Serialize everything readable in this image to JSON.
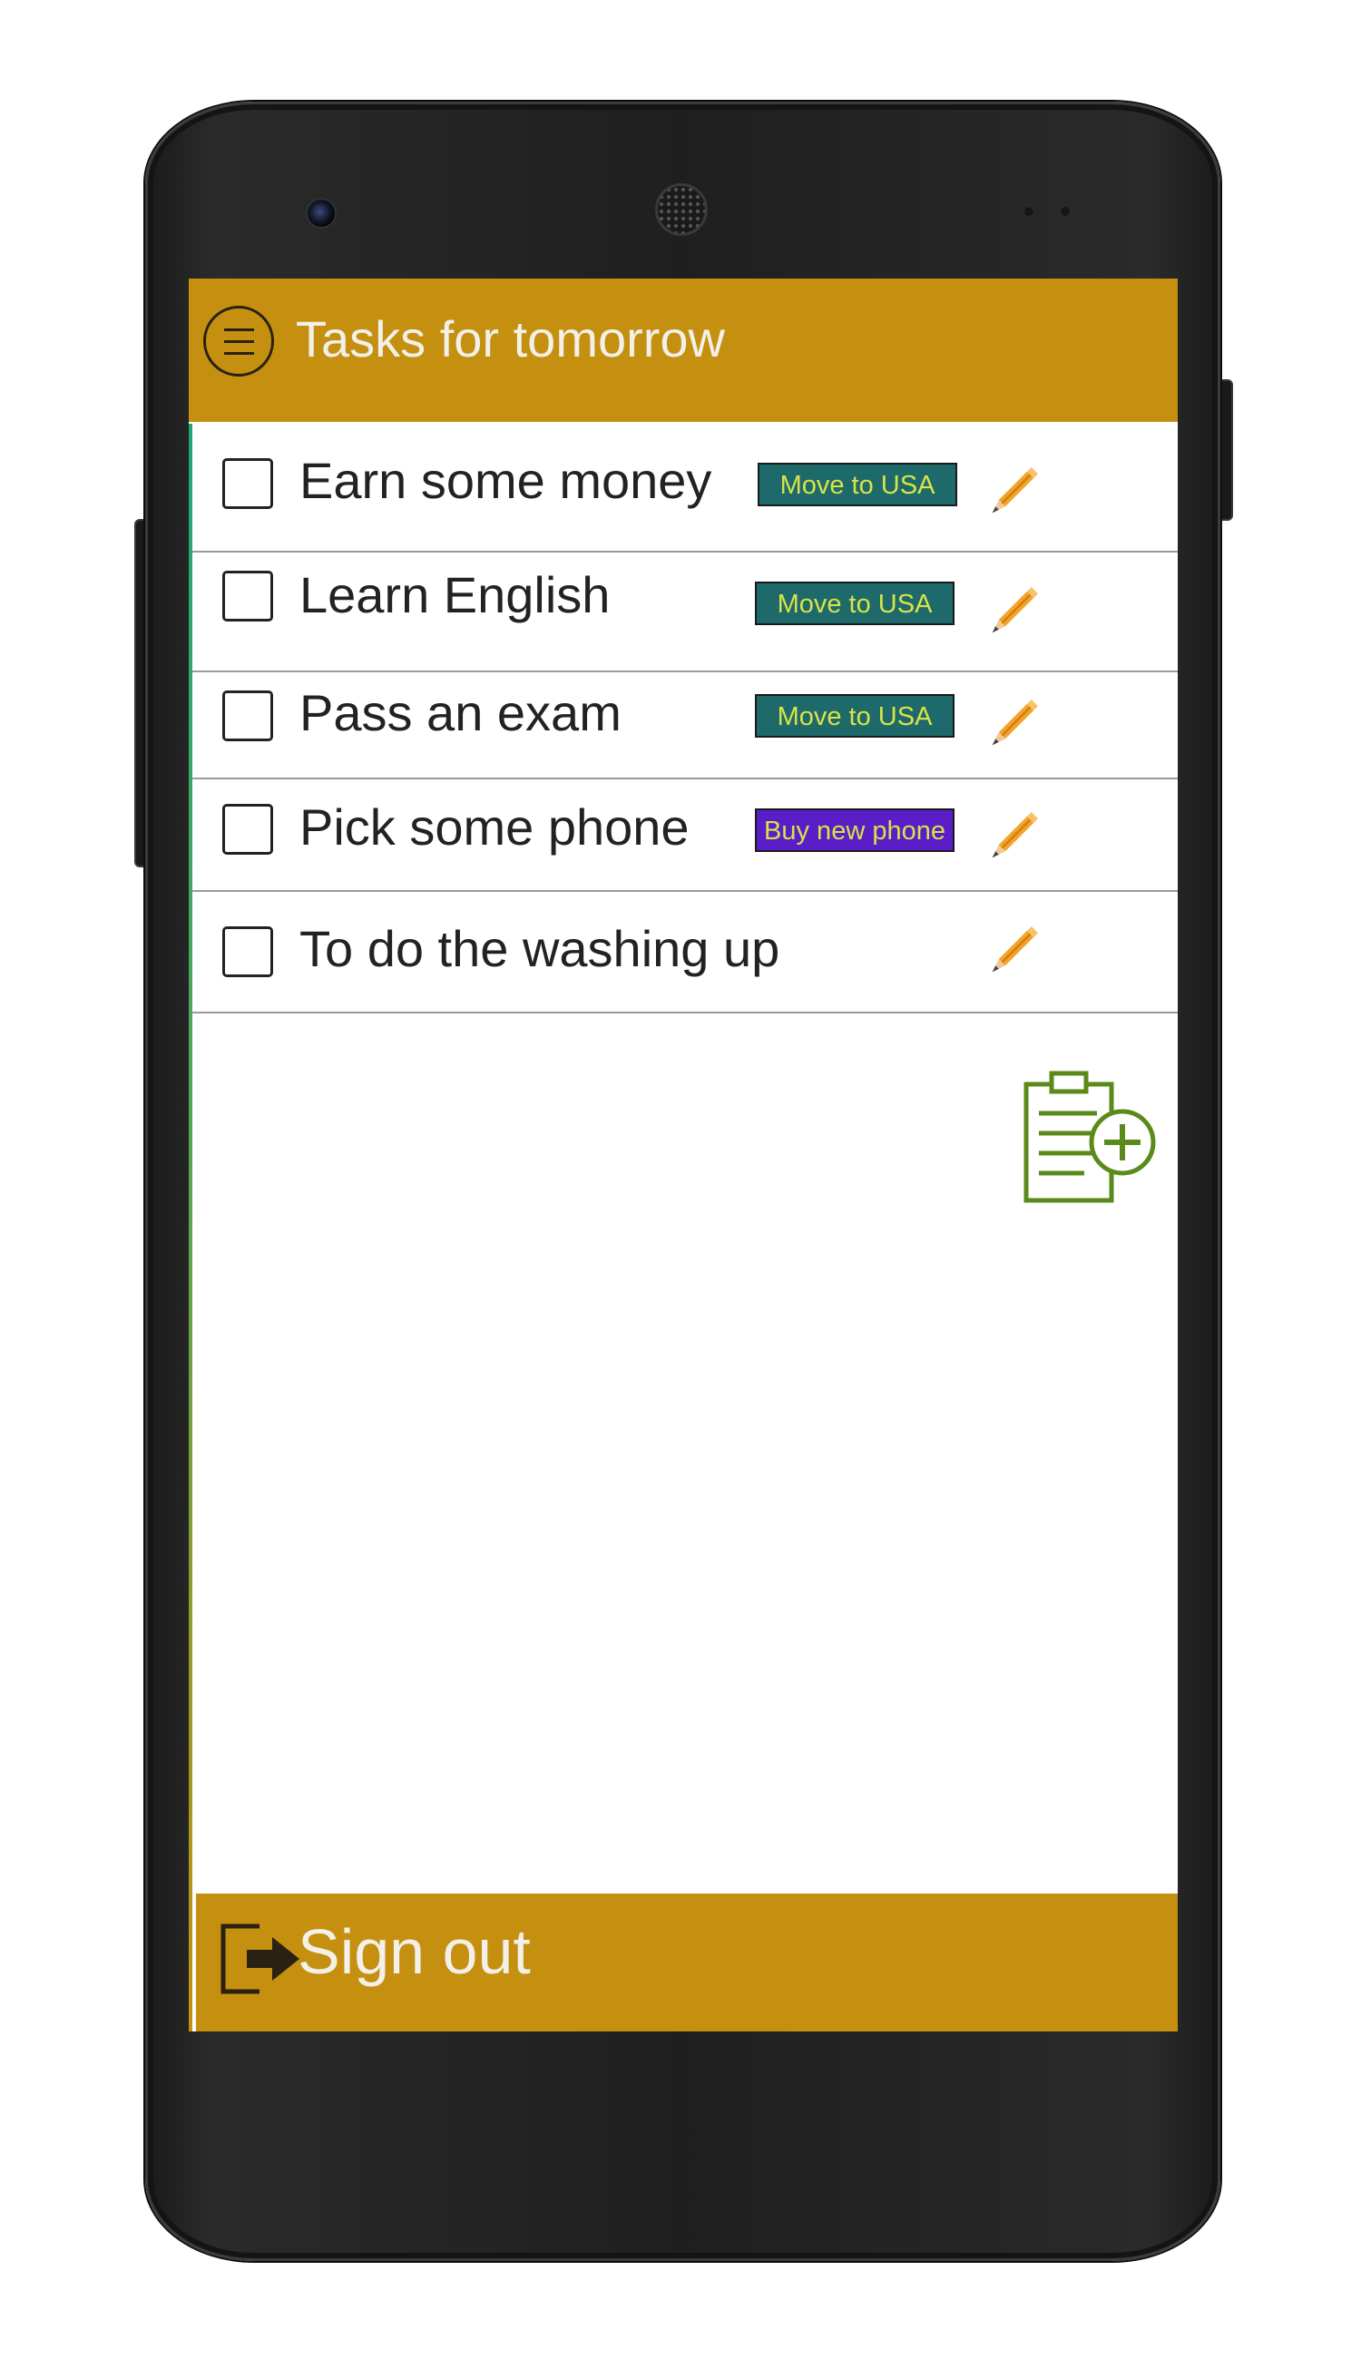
{
  "app_bar": {
    "title": "Tasks for tomorrow",
    "menu_icon": "hamburger-menu-icon"
  },
  "tasks": [
    {
      "text": "Earn some money",
      "checked": false,
      "tag": "Move to USA",
      "tag_color": "#1e6a6a",
      "edit_icon": "pencil-icon"
    },
    {
      "text": "Learn English",
      "checked": false,
      "tag": "Move to USA",
      "tag_color": "#1e6a6a",
      "edit_icon": "pencil-icon"
    },
    {
      "text": "Pass an exam",
      "checked": false,
      "tag": "Move to USA",
      "tag_color": "#1e6a6a",
      "edit_icon": "pencil-icon"
    },
    {
      "text": "Pick some phone",
      "checked": false,
      "tag": "Buy new phone",
      "tag_color": "#5a1ec8",
      "edit_icon": "pencil-icon"
    },
    {
      "text": "To do the washing up",
      "checked": false,
      "tag": "",
      "edit_icon": "pencil-icon"
    }
  ],
  "add_task": {
    "icon": "clipboard-add-icon",
    "color": "#5a8a1a"
  },
  "footer": {
    "signout_label": "Sign out",
    "signout_icon": "sign-out-icon"
  },
  "colors": {
    "accent": "#c58f10",
    "title_text": "#f2f0e8",
    "tag_text": "#d8e24a"
  }
}
